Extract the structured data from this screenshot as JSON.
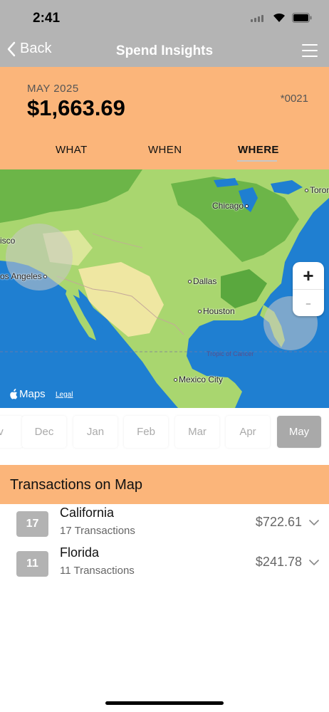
{
  "status": {
    "time": "2:41"
  },
  "nav": {
    "back_label": "Back",
    "title": "Spend Insights"
  },
  "summary": {
    "period": "MAY 2025",
    "amount": "$1,663.69",
    "card": "*0021"
  },
  "tabs": [
    {
      "label": "WHAT",
      "active": false
    },
    {
      "label": "WHEN",
      "active": false
    },
    {
      "label": "WHERE",
      "active": true
    }
  ],
  "map": {
    "cities": [
      "Chicago",
      "Toronto",
      "isco",
      "os Angeles",
      "Dallas",
      "Houston",
      "Mexico City"
    ],
    "tropic_label": "Tropic of Cancer",
    "attribution": "Maps",
    "legal": "Legal",
    "zoom_in": "+",
    "zoom_out": "-",
    "colors": {
      "ocean": "#1f7fd1",
      "land": "#a9d66f",
      "forest": "#5aa83e",
      "desert": "#efe7a2"
    }
  },
  "months": [
    {
      "label": "v",
      "selected": false
    },
    {
      "label": "Dec",
      "selected": false
    },
    {
      "label": "Jan",
      "selected": false
    },
    {
      "label": "Feb",
      "selected": false
    },
    {
      "label": "Mar",
      "selected": false
    },
    {
      "label": "Apr",
      "selected": false
    },
    {
      "label": "May",
      "selected": true
    }
  ],
  "transactions": {
    "header": "Transactions on Map",
    "items": [
      {
        "badge": "17",
        "name": "California",
        "count": "17 Transactions",
        "amount": "$722.61"
      },
      {
        "badge": "11",
        "name": "Florida",
        "count": "11 Transactions",
        "amount": "$241.78"
      }
    ]
  },
  "colors": {
    "accent": "#fbb57a",
    "bar": "#b4b4b4",
    "badge": "#b3b3b3"
  }
}
